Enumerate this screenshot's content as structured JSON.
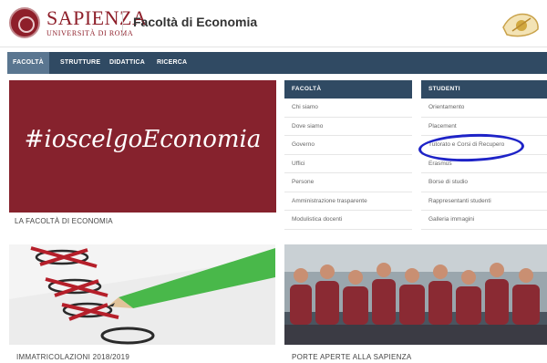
{
  "header": {
    "brand_name": "SAPIENZA",
    "brand_sub": "UNIVERSITÀ DI ROMA",
    "title": "Facoltà di Economia"
  },
  "nav": {
    "items": [
      {
        "label": "FACOLTÀ",
        "active": true
      },
      {
        "label": "STRUTTURE",
        "active": false
      },
      {
        "label": "DIDATTICA",
        "active": false
      },
      {
        "label": "RICERCA",
        "active": false
      }
    ]
  },
  "hero": {
    "headline": "#ioscelgoEconomia",
    "caption": "LA FACOLTÀ DI ECONOMIA"
  },
  "facolta_panel": {
    "title": "FACOLTÀ",
    "items": [
      "Chi siamo",
      "Dove siamo",
      "Governo",
      "Uffici",
      "Persone",
      "Amministrazione trasparente",
      "Modulistica docenti"
    ]
  },
  "studenti_panel": {
    "title": "STUDENTI",
    "items": [
      "Orientamento",
      "Placement",
      "Tutorato e Corsi di Recupero",
      "Erasmus",
      "Borse di studio",
      "Rappresentanti studenti",
      "Galleria immagini"
    ]
  },
  "cards": [
    {
      "caption": "IMMATRICOLAZIONI 2018/2019"
    },
    {
      "caption": "PORTE APERTE ALLA SAPIENZA"
    }
  ],
  "colors": {
    "brand": "#8e1f2a",
    "nav": "#304a63",
    "highlight_circle": "#1e23c7"
  }
}
